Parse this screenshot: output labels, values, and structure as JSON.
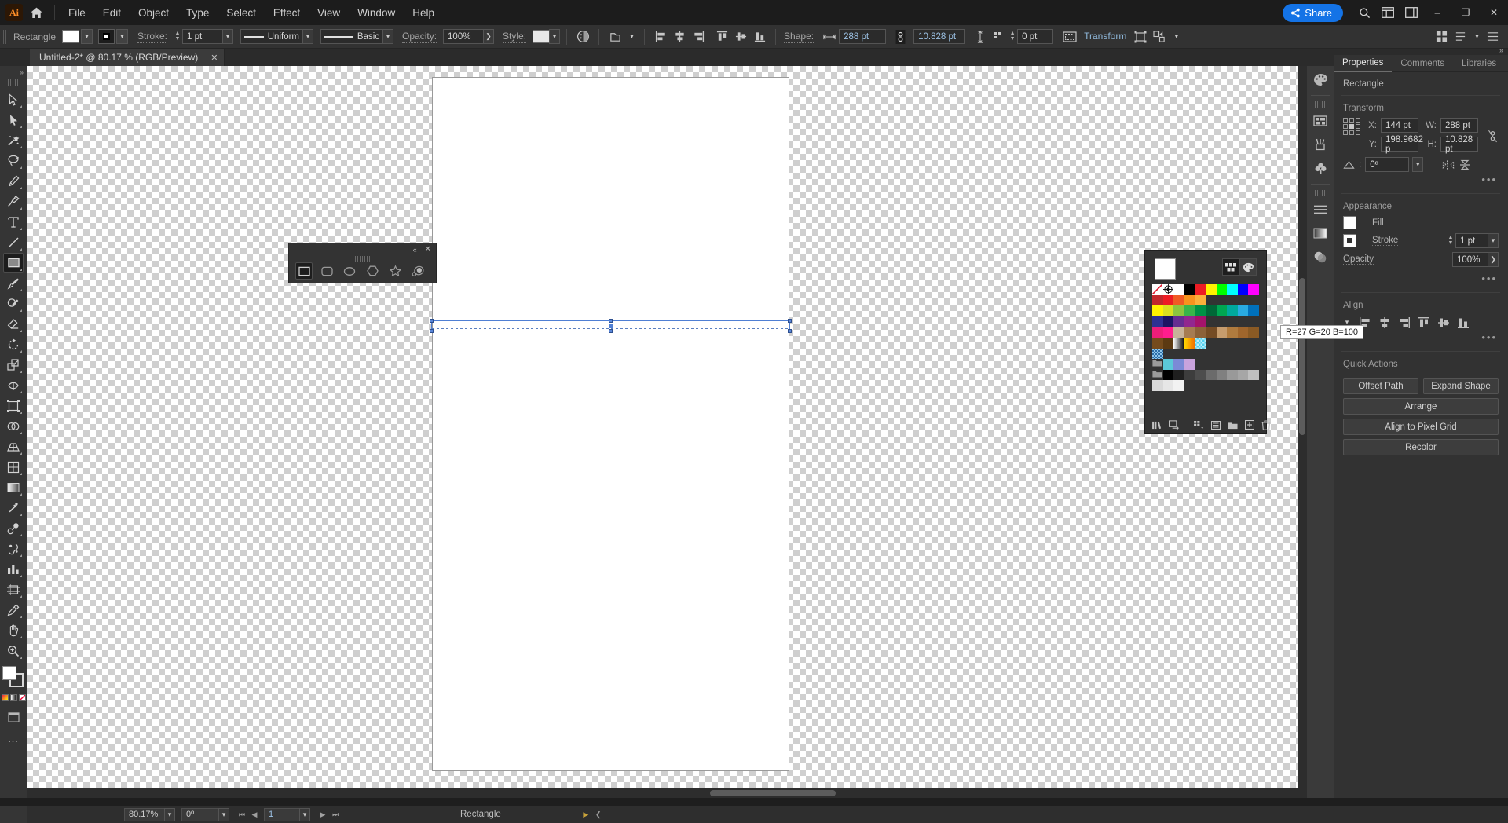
{
  "app": {
    "name": "Adobe Illustrator",
    "logo_text": "Ai"
  },
  "menubar": {
    "items": [
      "File",
      "Edit",
      "Object",
      "Type",
      "Select",
      "Effect",
      "View",
      "Window",
      "Help"
    ],
    "share_label": "Share",
    "search_icon": "search-icon",
    "home_icon": "home-icon",
    "arrange_icon": "arrange-documents-icon",
    "workspace_icon": "workspace-switcher-icon",
    "window_minimize": "–",
    "window_maximize": "❐",
    "window_close": "✕"
  },
  "controlbar": {
    "tool_name": "Rectangle",
    "fill_color": "#ffffff",
    "stroke_label": "Stroke:",
    "stroke_weight": "1 pt",
    "stroke_profile": "Uniform",
    "brush_definition": "Basic",
    "opacity_label": "Opacity:",
    "opacity_value": "100%",
    "style_label": "Style:",
    "shape_label": "Shape:",
    "shape_width": "288 pt",
    "shape_height": "10.828 pt",
    "corner_radius": "0 pt",
    "transform_label": "Transform",
    "link_icon": "link-broken-icon",
    "align_icons": [
      "align-left-icon",
      "align-center-h-icon",
      "align-right-icon",
      "align-top-icon",
      "align-center-v-icon",
      "align-bottom-icon"
    ],
    "recolor_icon": "recolor-artwork-icon",
    "isolate_icon": "isolate-selected-icon",
    "select_similar_icon": "select-similar-icon"
  },
  "document_tab": {
    "title": "Untitled-2* @ 80.17 % (RGB/Preview)",
    "close_icon": "close-icon"
  },
  "toolbar": {
    "tools": [
      {
        "name": "selection-tool",
        "glyph": "arrow-outline"
      },
      {
        "name": "direct-selection-tool",
        "glyph": "arrow-solid"
      },
      {
        "name": "magic-wand-tool",
        "glyph": "wand"
      },
      {
        "name": "lasso-tool",
        "glyph": "lasso"
      },
      {
        "name": "pen-tool",
        "glyph": "pen"
      },
      {
        "name": "curvature-tool",
        "glyph": "curvature"
      },
      {
        "name": "type-tool",
        "glyph": "type"
      },
      {
        "name": "line-segment-tool",
        "glyph": "line"
      },
      {
        "name": "rectangle-tool",
        "glyph": "rectangle",
        "active": true
      },
      {
        "name": "paintbrush-tool",
        "glyph": "brush"
      },
      {
        "name": "shaper-tool",
        "glyph": "shaper"
      },
      {
        "name": "eraser-tool",
        "glyph": "eraser"
      },
      {
        "name": "rotate-tool",
        "glyph": "rotate"
      },
      {
        "name": "scale-tool",
        "glyph": "scale"
      },
      {
        "name": "width-tool",
        "glyph": "width"
      },
      {
        "name": "free-transform-tool",
        "glyph": "free-transform"
      },
      {
        "name": "shape-builder-tool",
        "glyph": "shape-builder"
      },
      {
        "name": "perspective-grid-tool",
        "glyph": "perspective"
      },
      {
        "name": "mesh-tool",
        "glyph": "mesh"
      },
      {
        "name": "gradient-tool",
        "glyph": "gradient"
      },
      {
        "name": "eyedropper-tool",
        "glyph": "eyedropper"
      },
      {
        "name": "blend-tool",
        "glyph": "blend"
      },
      {
        "name": "symbol-sprayer-tool",
        "glyph": "symbol"
      },
      {
        "name": "column-graph-tool",
        "glyph": "graph"
      },
      {
        "name": "artboard-tool",
        "glyph": "artboard"
      },
      {
        "name": "slice-tool",
        "glyph": "slice"
      },
      {
        "name": "hand-tool",
        "glyph": "hand"
      },
      {
        "name": "zoom-tool",
        "glyph": "zoom"
      }
    ],
    "fill_color": "#ffffff",
    "stroke_color": "#ffffff",
    "more_label": "…",
    "edit_toolbar_icon": "edit-toolbar-icon"
  },
  "shapes_panel": {
    "collapse_icon": "collapse-icon",
    "close_icon": "close-icon",
    "tools": [
      {
        "name": "rectangle-shape",
        "glyph": "square",
        "active": true
      },
      {
        "name": "rounded-rectangle-shape",
        "glyph": "rounded-square"
      },
      {
        "name": "ellipse-shape",
        "glyph": "ellipse"
      },
      {
        "name": "polygon-shape",
        "glyph": "hexagon"
      },
      {
        "name": "star-shape",
        "glyph": "star"
      },
      {
        "name": "flare-shape",
        "glyph": "flare"
      }
    ]
  },
  "properties_panel": {
    "tabs": [
      {
        "label": "Properties",
        "active": true
      },
      {
        "label": "Comments",
        "active": false
      },
      {
        "label": "Libraries",
        "active": false
      }
    ],
    "object_type": "Rectangle",
    "transform": {
      "heading": "Transform",
      "x_label": "X:",
      "x_value": "144 pt",
      "y_label": "Y:",
      "y_value": "198.9682 p",
      "w_label": "W:",
      "w_value": "288 pt",
      "h_label": "H:",
      "h_value": "10.828 pt",
      "angle_label": "angle-icon",
      "angle_value": "0º",
      "link_icon": "link-broken-icon",
      "flip_h_icon": "flip-horizontal-icon",
      "flip_v_icon": "flip-vertical-icon",
      "more_icon": "more-options-icon"
    },
    "appearance": {
      "heading": "Appearance",
      "fill_label": "Fill",
      "fill_color": "#ffffff",
      "stroke_label": "Stroke",
      "stroke_value": "1 pt",
      "opacity_label": "Opacity",
      "opacity_value": "100%",
      "more_icon": "more-options-icon"
    },
    "align": {
      "heading": "Align",
      "icons": [
        "align-left-icon",
        "align-center-h-icon",
        "align-right-icon",
        "align-top-icon",
        "align-center-v-icon",
        "align-bottom-icon"
      ],
      "more_icon": "more-options-icon"
    },
    "quick_actions": {
      "heading": "Quick Actions",
      "buttons": [
        "Offset Path",
        "Expand Shape",
        "Arrange",
        "Align to Pixel Grid",
        "Recolor"
      ]
    },
    "rail_icons": [
      "color-panel-icon",
      "swatches-panel-icon",
      "brushes-panel-icon",
      "symbols-panel-icon",
      "align-panel-icon",
      "gradient-panel-icon",
      "transparency-panel-icon"
    ]
  },
  "swatches_panel": {
    "current_color": "#ffffff",
    "mode_swatches_icon": "swatches-grid-icon",
    "mode_color_icon": "color-palette-icon",
    "rows": [
      [
        "none",
        "registration",
        "#ffffff",
        "#000000",
        "#ed1c24",
        "#fff200",
        "#00ff00",
        "#00ffff",
        "#0000ff",
        "#ff00ff",
        "#c1272d",
        "#ed1c24",
        "#f15a24",
        "#f7931e",
        "#fbb03b"
      ],
      [
        "#fff200",
        "#d9e021",
        "#8cc63f",
        "#39b54a",
        "#009245",
        "#006837",
        "#00a651",
        "#00a99d",
        "#29abe2",
        "#0071bc",
        "#2e3192",
        "#1b1464",
        "#662d91",
        "#92278f",
        "#a4136b"
      ],
      [
        "#ed1e79",
        "#ff1d8d",
        "#c7b299",
        "#a67c52",
        "#8c6239",
        "#754c24",
        "#c69c6d",
        "#b07b3e",
        "#a0662c",
        "#8a5a24",
        "#754b1c",
        "#5c3a12",
        "gradient-white-black",
        "gradient-orange",
        "pattern-check"
      ],
      [
        "pattern-blue-texture"
      ],
      [
        "folder",
        "#5bc8d8",
        "#7b8ad6",
        "#c9a3dd"
      ],
      [
        "folder",
        "#000000",
        "#1f1f1f",
        "#3d3d3d",
        "#4d4d4d",
        "#6b6b6b",
        "#808080",
        "#999999",
        "#a6a6a6",
        "#bfbfbf",
        "#d9d9d9",
        "#e6e6e6",
        "#f2f2f2"
      ]
    ],
    "footer_icons": [
      "swatch-libraries-icon",
      "show-swatch-kinds-icon",
      "swatch-options-icon",
      "new-color-group-icon",
      "new-swatch-icon",
      "delete-swatch-icon"
    ],
    "tooltip": "R=27 G=20 B=100"
  },
  "statusbar": {
    "zoom_level": "80.17%",
    "rotate_value": "0º",
    "artboard_number": "1",
    "status_text": "Rectangle",
    "first_icon": "first-artboard-icon",
    "prev_icon": "previous-artboard-icon",
    "next_icon": "next-artboard-icon",
    "last_icon": "last-artboard-icon"
  },
  "colors": {
    "accent_blue": "#1473e6",
    "panel_bg": "#323232",
    "toolbar_bg": "#353535",
    "menubar_bg": "#1c1c1c",
    "selection_blue": "#4f7fd4",
    "link_text": "#8fb7d9"
  }
}
